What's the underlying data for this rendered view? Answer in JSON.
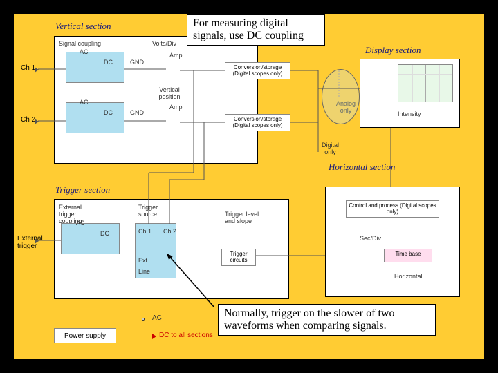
{
  "callouts": {
    "top": "For measuring digital signals, use DC coupling",
    "bottom": "Normally, trigger on the slower of two waveforms when comparing signals."
  },
  "sections": {
    "vertical": "Vertical section",
    "trigger": "Trigger section",
    "display": "Display section",
    "horizontal": "Horizontal section"
  },
  "labels": {
    "ch1": "Ch 1",
    "ch2": "Ch 2",
    "ext_trigger": "External trigger",
    "signal_coupling": "Signal coupling",
    "volts_div": "Volts/Div",
    "ac": "AC",
    "dc": "DC",
    "gnd": "GND",
    "amp": "Amp",
    "vertical_position": "Vertical position",
    "conversion": "Conversion/storage (Digital scopes only)",
    "analog_only": "Analog only",
    "intensity": "Intensity",
    "digital_only": "Digital only",
    "ext_trigger_coupling": "External trigger coupling",
    "trigger_source": "Trigger source",
    "ch1_src": "Ch 1",
    "ch2_src": "Ch 2",
    "ext": "Ext",
    "line": "Line",
    "trigger_level": "Trigger level and slope",
    "trigger_circuits": "Trigger circuits",
    "control_process": "Control and process (Digital scopes only)",
    "sec_div": "Sec/Div",
    "time_base": "Time base",
    "horizontal_label": "Horizontal",
    "power_supply": "Power supply",
    "dc_to_all": "DC to all sections"
  }
}
